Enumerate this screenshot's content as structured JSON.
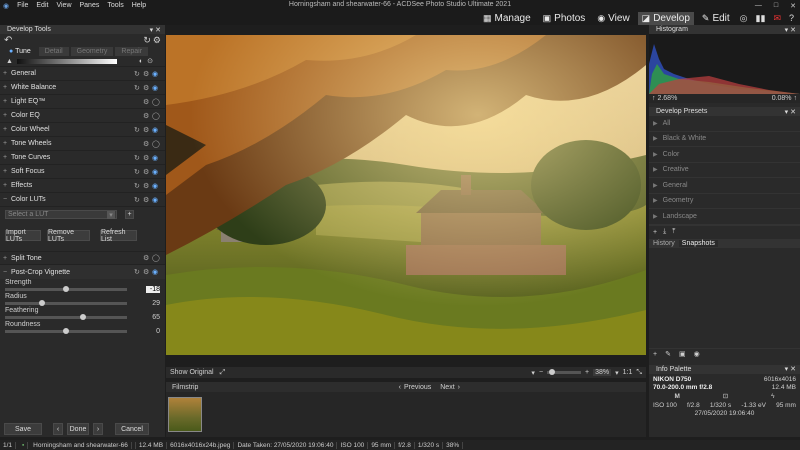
{
  "window": {
    "title": "Horningsham and shearwater-66 - ACDSee Photo Studio Ultimate 2021",
    "menu": [
      "File",
      "Edit",
      "View",
      "Panes",
      "Tools",
      "Help"
    ]
  },
  "modes": [
    {
      "icon": "grid-icon",
      "glyph": "▦",
      "label": "Manage"
    },
    {
      "icon": "photos-icon",
      "glyph": "▣",
      "label": "Photos"
    },
    {
      "icon": "eye-icon",
      "glyph": "◉",
      "label": "View"
    },
    {
      "icon": "develop-icon",
      "glyph": "◪",
      "label": "Develop",
      "active": true
    },
    {
      "icon": "edit-icon",
      "glyph": "✎",
      "label": "Edit"
    }
  ],
  "modebar_icons": [
    "365-icon",
    "stats-icon",
    "mail-icon"
  ],
  "left_panel": {
    "title": "Develop Tools",
    "tabs": [
      "Tune",
      "Detail",
      "Geometry",
      "Repair"
    ],
    "sections": [
      "General",
      "White Balance",
      "Light EQ™",
      "Color EQ",
      "Color Wheel",
      "Tone Wheels",
      "Tone Curves",
      "Soft Focus",
      "Effects",
      "Color LUTs"
    ],
    "lut_placeholder": "Select a LUT",
    "lut_buttons": [
      "Import LUTs",
      "Remove LUTs",
      "Refresh List"
    ],
    "split_tone": "Split Tone",
    "vignette": {
      "title": "Post-Crop Vignette",
      "sliders": [
        {
          "label": "Strength",
          "value": "-18",
          "pos": 0.5
        },
        {
          "label": "Radius",
          "value": "29",
          "pos": 0.29
        },
        {
          "label": "Feathering",
          "value": "65",
          "pos": 0.65
        },
        {
          "label": "Roundness",
          "value": "0",
          "pos": 0.5
        }
      ]
    },
    "bottom_buttons": {
      "save": "Save",
      "done": "Done",
      "cancel": "Cancel"
    }
  },
  "image_bar": {
    "show_original": "Show Original",
    "zoom": "38%",
    "ratio": "1:1"
  },
  "filmstrip": {
    "title": "Filmstrip",
    "prev": "Previous",
    "next": "Next"
  },
  "right_panel": {
    "histogram": {
      "title": "Histogram",
      "low": "2.68%",
      "high": "0.08%"
    },
    "presets": {
      "title": "Develop Presets",
      "items": [
        "All",
        "Black & White",
        "Color",
        "Creative",
        "General",
        "Geometry",
        "Landscape"
      ]
    },
    "history_tabs": [
      "History",
      "Snapshots"
    ],
    "info": {
      "title": "Info Palette",
      "camera": "NIKON D750",
      "dims": "6016x4016",
      "lens": "70.0-200.0 mm f/2.8",
      "size": "12.4 MB",
      "mode": "M",
      "iso": "ISO 100",
      "aperture": "f/2.8",
      "shutter": "1/320 s",
      "ev": "-1.33 eV",
      "focal": "95 mm",
      "date": "27/05/2020 19:06:40"
    }
  },
  "status": {
    "count": "1/1",
    "file": "Horningsham and shearwater-66",
    "size": "12.4 MB",
    "dims": "6016x4016x24b.jpeg",
    "date": "Date Taken: 27/05/2020 19:06:40",
    "iso": "ISO 100",
    "focal": "95 mm",
    "aperture": "f/2.8",
    "shutter": "1/320 s",
    "zoom": "38%"
  }
}
